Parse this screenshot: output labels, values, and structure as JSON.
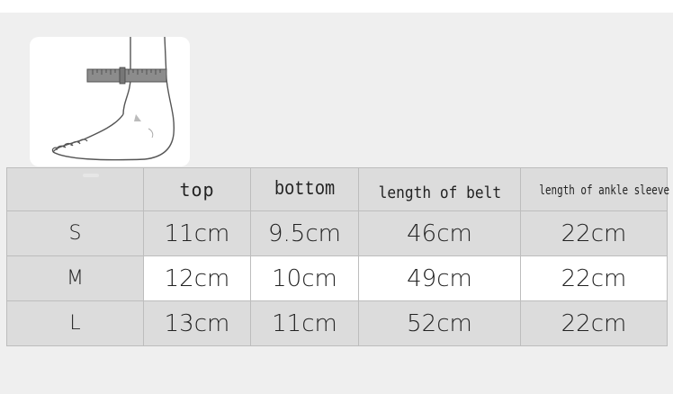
{
  "table": {
    "headers": {
      "top": "top",
      "bottom": "bottom",
      "belt": "length of belt",
      "sleeve": "length of ankle sleeve"
    },
    "rows": [
      {
        "size": "S",
        "top": "11cm",
        "bottom": "9.5cm",
        "belt": "46cm",
        "sleeve": "22cm"
      },
      {
        "size": "M",
        "top": "12cm",
        "bottom": "10cm",
        "belt": "49cm",
        "sleeve": "22cm"
      },
      {
        "size": "L",
        "top": "13cm",
        "bottom": "11cm",
        "belt": "52cm",
        "sleeve": "22cm"
      }
    ]
  },
  "colors": {
    "panel_background": "#efefef",
    "label_cell_background": "#dcdcdc",
    "value_cell_background": "#ffffff",
    "border": "#bdbdbd",
    "tape_measure": "#8c8c8c"
  }
}
